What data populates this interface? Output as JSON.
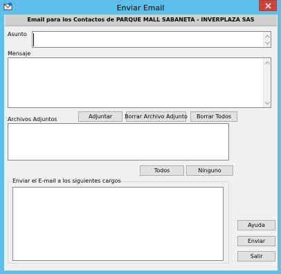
{
  "window": {
    "title": "Enviar Email"
  },
  "header": {
    "text": "Email para los Contactos de  PARQUE MALL SABANETA - INVERPLAZA SAS"
  },
  "asunto": {
    "label": "Asunto",
    "value": ""
  },
  "mensaje": {
    "label": "Mensaje",
    "value": ""
  },
  "adjuntos": {
    "label": "Archivos Adjuntos",
    "adjuntar_label": "Adjuntar",
    "borrar_label": "Borrar Archivo Adjunto",
    "borrar_todos_label": "Borrar Todos"
  },
  "seleccion": {
    "todos_label": "Todos",
    "ninguno_label": "Ninguno"
  },
  "cargos": {
    "group_label": "Enviar el E-mail a los siguientes cargos"
  },
  "actions": {
    "ayuda_label": "Ayuda",
    "enviar_label": "Enviar",
    "salir_label": "Salir"
  },
  "colors": {
    "titlebar": "#5ebfe9",
    "close_button": "#c7463f",
    "client_background": "#f0f0f0"
  },
  "icons": {
    "app": "envelope-icon",
    "close": "close-icon",
    "scroll_up": "chevron-up-icon",
    "scroll_down": "chevron-down-icon"
  }
}
